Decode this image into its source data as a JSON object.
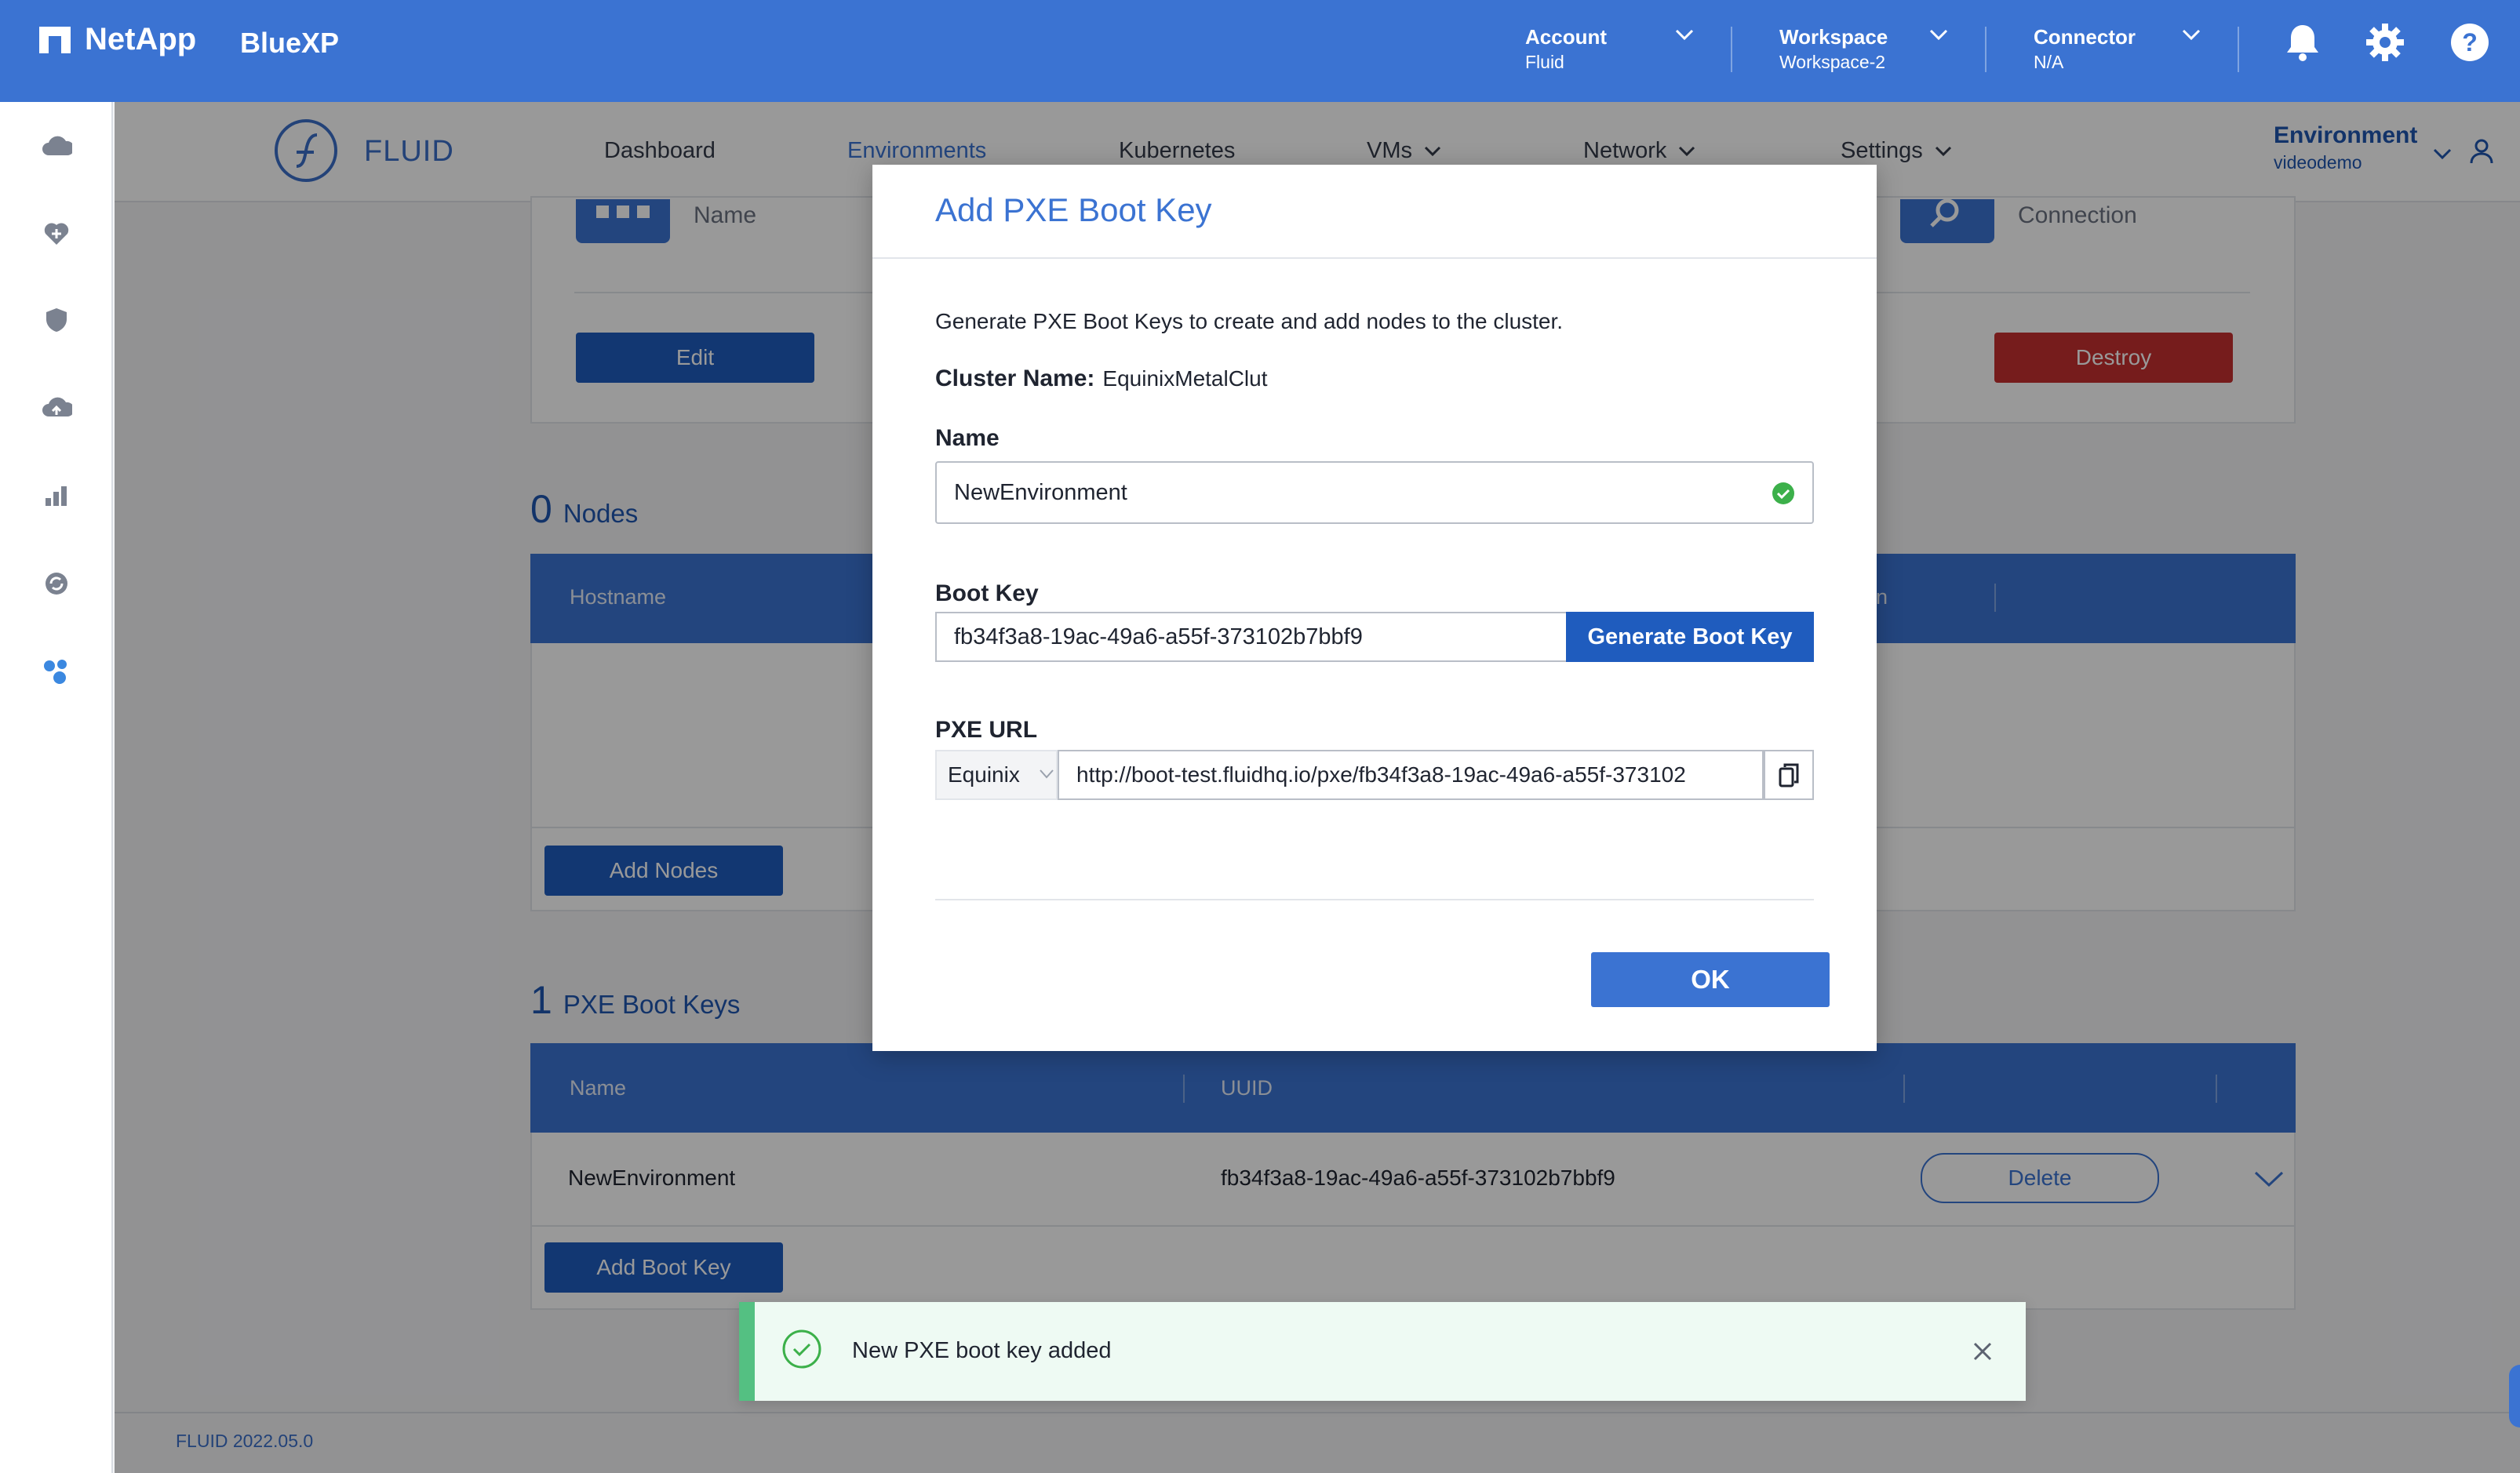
{
  "topbar": {
    "brand": "NetApp",
    "product": "BlueXP",
    "account": {
      "label": "Account",
      "value": "Fluid"
    },
    "workspace": {
      "label": "Workspace",
      "value": "Workspace-2"
    },
    "connector": {
      "label": "Connector",
      "value": "N/A"
    },
    "icons": [
      "bell-icon",
      "gear-icon",
      "help-icon"
    ]
  },
  "sidebar": {
    "icons": [
      "cloud-storage-icon",
      "health-icon",
      "protection-icon",
      "cloud-sync-icon",
      "analytics-icon",
      "mobility-icon",
      "fluid-icon"
    ]
  },
  "subnav": {
    "brand": "FLUID",
    "tabs": [
      {
        "label": "Dashboard"
      },
      {
        "label": "Environments"
      },
      {
        "label": "Kubernetes"
      },
      {
        "label": "VMs"
      },
      {
        "label": "Network"
      },
      {
        "label": "Settings"
      }
    ],
    "environment": {
      "label": "Environment",
      "value": "videodemo"
    }
  },
  "background": {
    "name_label": "Name",
    "connection_label": "Connection",
    "edit": "Edit",
    "destroy": "Destroy",
    "nodes": {
      "count": "0",
      "title": "Nodes",
      "header_hostname": "Hostname",
      "header_partial": "on",
      "add": "Add Nodes"
    },
    "bootkeys": {
      "count": "1",
      "title": "PXE Boot Keys",
      "headers": [
        "Name",
        "UUID"
      ],
      "rows": [
        {
          "name": "NewEnvironment",
          "uuid": "fb34f3a8-19ac-49a6-a55f-373102b7bbf9",
          "action": "Delete"
        }
      ],
      "add": "Add Boot Key"
    }
  },
  "dialog": {
    "title": "Add PXE Boot Key",
    "description": "Generate PXE Boot Keys to create and add nodes to the cluster.",
    "cluster_label": "Cluster Name:",
    "cluster_value": "EquinixMetalClut",
    "name_label": "Name",
    "name_value": "NewEnvironment",
    "bootkey_label": "Boot Key",
    "bootkey_value": "fb34f3a8-19ac-49a6-a55f-373102b7bbf9",
    "generate": "Generate Boot Key",
    "pxe_label": "PXE URL",
    "provider": "Equinix",
    "pxe_value": "http://boot-test.fluidhq.io/pxe/fb34f3a8-19ac-49a6-a55f-373102",
    "ok": "OK"
  },
  "toast": {
    "message": "New PXE boot key added"
  },
  "footer": {
    "version": "FLUID 2022.05.0"
  }
}
